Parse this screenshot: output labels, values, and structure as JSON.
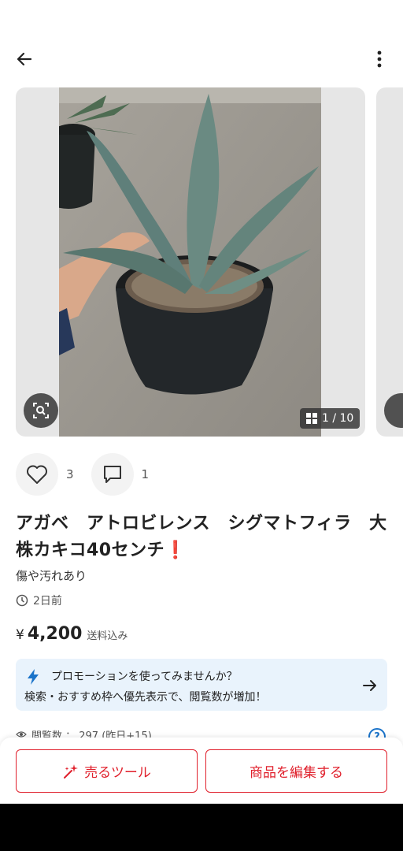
{
  "header": {
    "back_icon": "arrow-left-icon",
    "more_icon": "more-vertical-icon"
  },
  "gallery": {
    "counter": "1 / 10",
    "zoom_icon": "image-search-icon",
    "grid_icon": "grid-icon"
  },
  "engagement": {
    "likes": "3",
    "comments": "1",
    "like_icon": "heart-icon",
    "comment_icon": "comment-icon"
  },
  "item": {
    "title": "アガベ　アトロビレンス　シグマトフィラ　大株カキコ40センチ",
    "title_mark": "❗",
    "condition": "傷や汚れあり",
    "posted": "2日前",
    "currency": "¥",
    "price": "4,200",
    "shipping": "送料込み"
  },
  "promo": {
    "title": "プロモーションを使ってみませんか？",
    "description": "検索・おすすめ枠へ優先表示で、閲覧数が増加！",
    "accent": "#1a73c9",
    "background": "#e9f3fc"
  },
  "stats": {
    "views": "閲覧数 ： 297 (昨日+15)"
  },
  "actions": {
    "sell_tool": "売るツール",
    "edit": "商品を編集する",
    "accent": "#e0202c"
  }
}
